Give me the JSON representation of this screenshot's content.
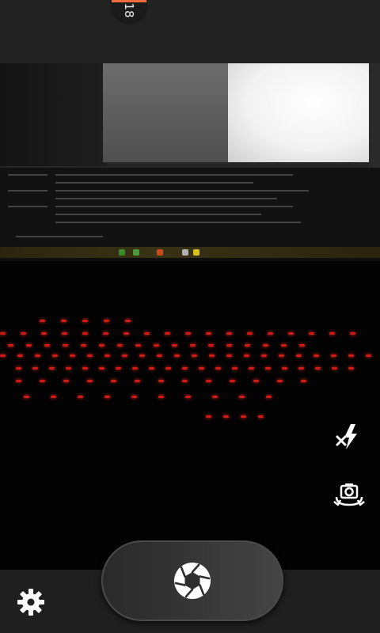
{
  "top_bar": {
    "timer_text": "18",
    "accent_color": "#f26b3a"
  },
  "controls": {
    "flash_icon": "flash-off-icon",
    "switch_camera_icon": "switch-camera-icon",
    "settings_icon": "gear-icon",
    "shutter_icon": "shutter-aperture-icon"
  }
}
